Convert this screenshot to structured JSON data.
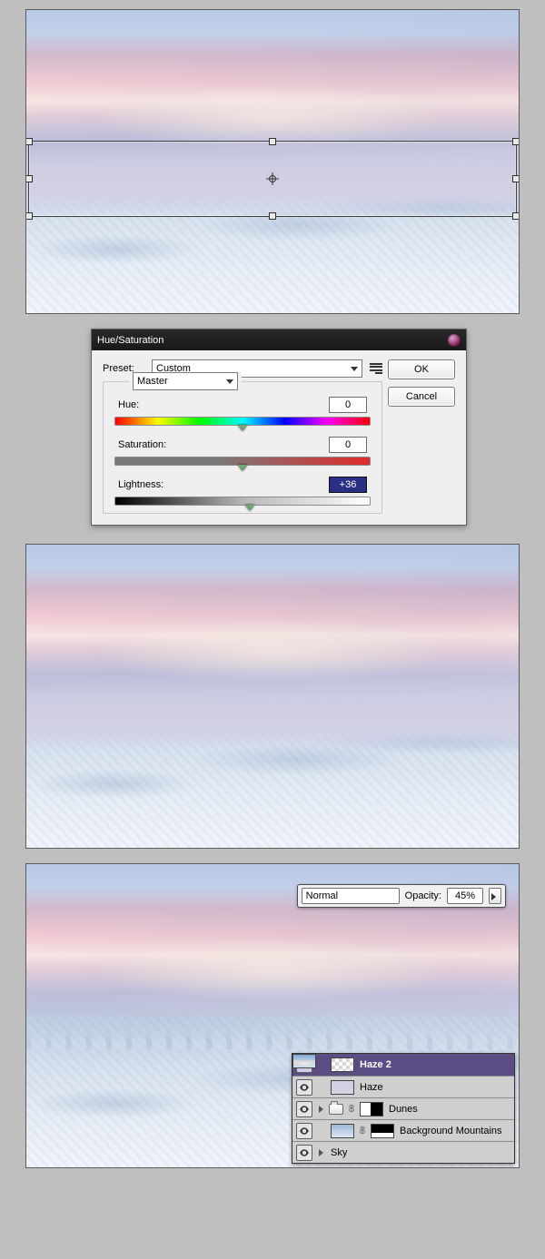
{
  "dialog": {
    "title": "Hue/Saturation",
    "preset_label": "Preset:",
    "preset_value": "Custom",
    "ok": "OK",
    "cancel": "Cancel",
    "channel": "Master",
    "hue_label": "Hue:",
    "hue_value": "0",
    "sat_label": "Saturation:",
    "sat_value": "0",
    "lig_label": "Lightness:",
    "lig_value": "+36"
  },
  "blend": {
    "mode": "Normal",
    "opacity_label": "Opacity:",
    "opacity_value": "45%"
  },
  "layers": [
    {
      "name": "Haze 2"
    },
    {
      "name": "Haze"
    },
    {
      "name": "Dunes"
    },
    {
      "name": "Background Mountains"
    },
    {
      "name": "Sky"
    }
  ]
}
